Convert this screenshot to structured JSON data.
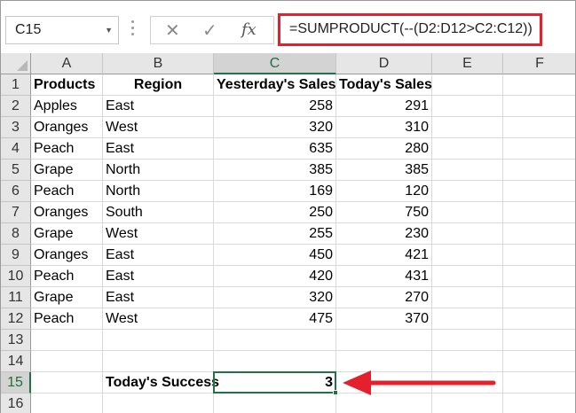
{
  "namebox": {
    "value": "C15"
  },
  "formula_bar": {
    "cancel_icon": "cancel-icon",
    "enter_icon": "check-icon",
    "fx_label": "fx",
    "formula": "=SUMPRODUCT(--(D2:D12>C2:C12))"
  },
  "columns": [
    "A",
    "B",
    "C",
    "D",
    "E",
    "F"
  ],
  "rows": [
    "1",
    "2",
    "3",
    "4",
    "5",
    "6",
    "7",
    "8",
    "9",
    "10",
    "11",
    "12",
    "13",
    "14",
    "15",
    "16"
  ],
  "header": {
    "products": "Products",
    "region": "Region",
    "yesterday": "Yesterday's Sales",
    "today": "Today's Sales"
  },
  "data": [
    {
      "product": "Apples",
      "region": "East",
      "yesterday": "258",
      "today": "291"
    },
    {
      "product": "Oranges",
      "region": "West",
      "yesterday": "320",
      "today": "310"
    },
    {
      "product": "Peach",
      "region": "East",
      "yesterday": "635",
      "today": "280"
    },
    {
      "product": "Grape",
      "region": "North",
      "yesterday": "385",
      "today": "385"
    },
    {
      "product": "Peach",
      "region": "North",
      "yesterday": "169",
      "today": "120"
    },
    {
      "product": "Oranges",
      "region": "South",
      "yesterday": "250",
      "today": "750"
    },
    {
      "product": "Grape",
      "region": "West",
      "yesterday": "255",
      "today": "230"
    },
    {
      "product": "Oranges",
      "region": "East",
      "yesterday": "450",
      "today": "421"
    },
    {
      "product": "Peach",
      "region": "East",
      "yesterday": "420",
      "today": "431"
    },
    {
      "product": "Grape",
      "region": "East",
      "yesterday": "320",
      "today": "270"
    },
    {
      "product": "Peach",
      "region": "West",
      "yesterday": "475",
      "today": "370"
    }
  ],
  "summary": {
    "label": "Today's Success",
    "value": "3"
  },
  "colors": {
    "selection": "#217346",
    "highlight": "#e3202b"
  }
}
